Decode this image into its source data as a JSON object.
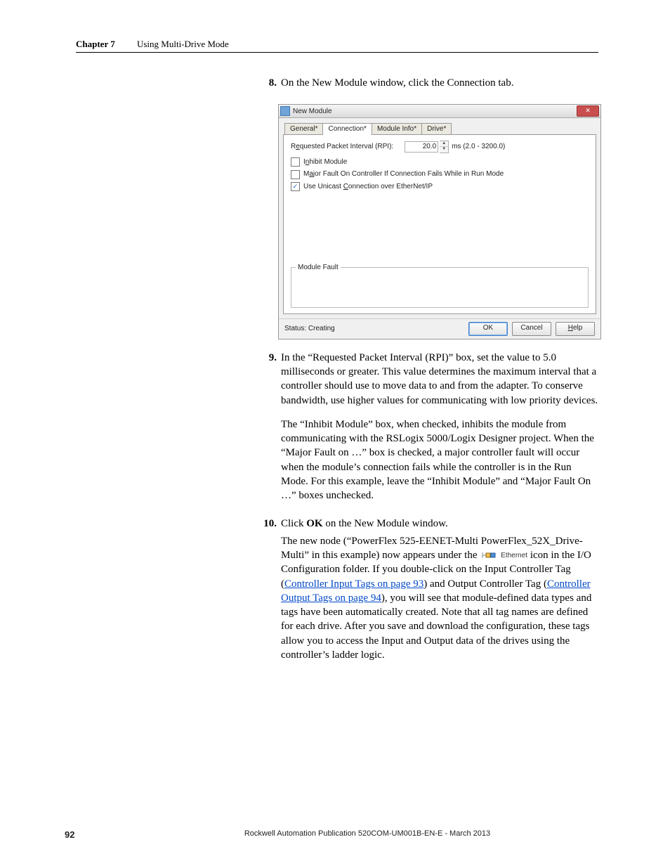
{
  "header": {
    "chapter_label": "Chapter 7",
    "chapter_title": "Using Multi-Drive Mode"
  },
  "steps": {
    "s8": {
      "num": "8.",
      "text": "On the New Module window, click the Connection tab."
    },
    "s9": {
      "num": "9.",
      "p1": "In the “Requested Packet Interval (RPI)” box, set the value to 5.0 milliseconds or greater. This value determines the maximum interval that a controller should use to move data to and from the adapter. To conserve bandwidth, use higher values for communicating with low priority devices.",
      "p2": "The “Inhibit Module” box, when checked, inhibits the module from communicating with the RSLogix 5000/Logix Designer project. When the “Major Fault on …” box is checked, a major controller fault will occur when the module’s connection fails while the controller is in the Run Mode. For this example, leave the “Inhibit Module” and “Major Fault On …” boxes unchecked."
    },
    "s10": {
      "num": "10.",
      "lead": "Click ",
      "ok": "OK",
      "lead2": " on the New Module window.",
      "body_a": "The new node (“PowerFlex 525-EENET-Multi PowerFlex_52X_Drive-Multi” in this example) now appears under the ",
      "icon_label": "Ethernet",
      "body_b": " icon in the I/O Configuration folder. If you double-click on the Input Controller Tag (",
      "link1": "Controller Input Tags on page 93",
      "body_c": ") and Output Controller Tag (",
      "link2": "Controller Output Tags on page 94",
      "body_d": "), you will see that module-defined data types and tags have been automatically created. Note that all tag names are defined for each drive. After you save and download the configuration, these tags allow you to access the Input and Output data of the drives using the controller’s ladder logic."
    }
  },
  "dialog": {
    "title": "New Module",
    "tabs": {
      "general": "General*",
      "connection": "Connection*",
      "moduleinfo": "Module Info*",
      "drive": "Drive*"
    },
    "rpi_label_pre": "R",
    "rpi_label_key": "e",
    "rpi_label_post": "quested Packet Interval (RPI):",
    "rpi_value": "20.0",
    "rpi_unit": "ms (2.0 - 3200.0)",
    "inhibit_pre": "I",
    "inhibit_key": "n",
    "inhibit_post": "hibit Module",
    "major_pre": "M",
    "major_key": "a",
    "major_post": "jor Fault On Controller If Connection Fails While in Run Mode",
    "unicast_pre": "Use Unicast ",
    "unicast_key": "C",
    "unicast_post": "onnection over EtherNet/IP",
    "unicast_checked": "✓",
    "fault_legend": "Module Fault",
    "status": "Status: Creating",
    "ok": "OK",
    "cancel": "Cancel",
    "help_pre": "",
    "help_key": "H",
    "help_post": "elp"
  },
  "footer": {
    "page": "92",
    "pub": "Rockwell Automation Publication 520COM-UM001B-EN-E - March 2013"
  }
}
